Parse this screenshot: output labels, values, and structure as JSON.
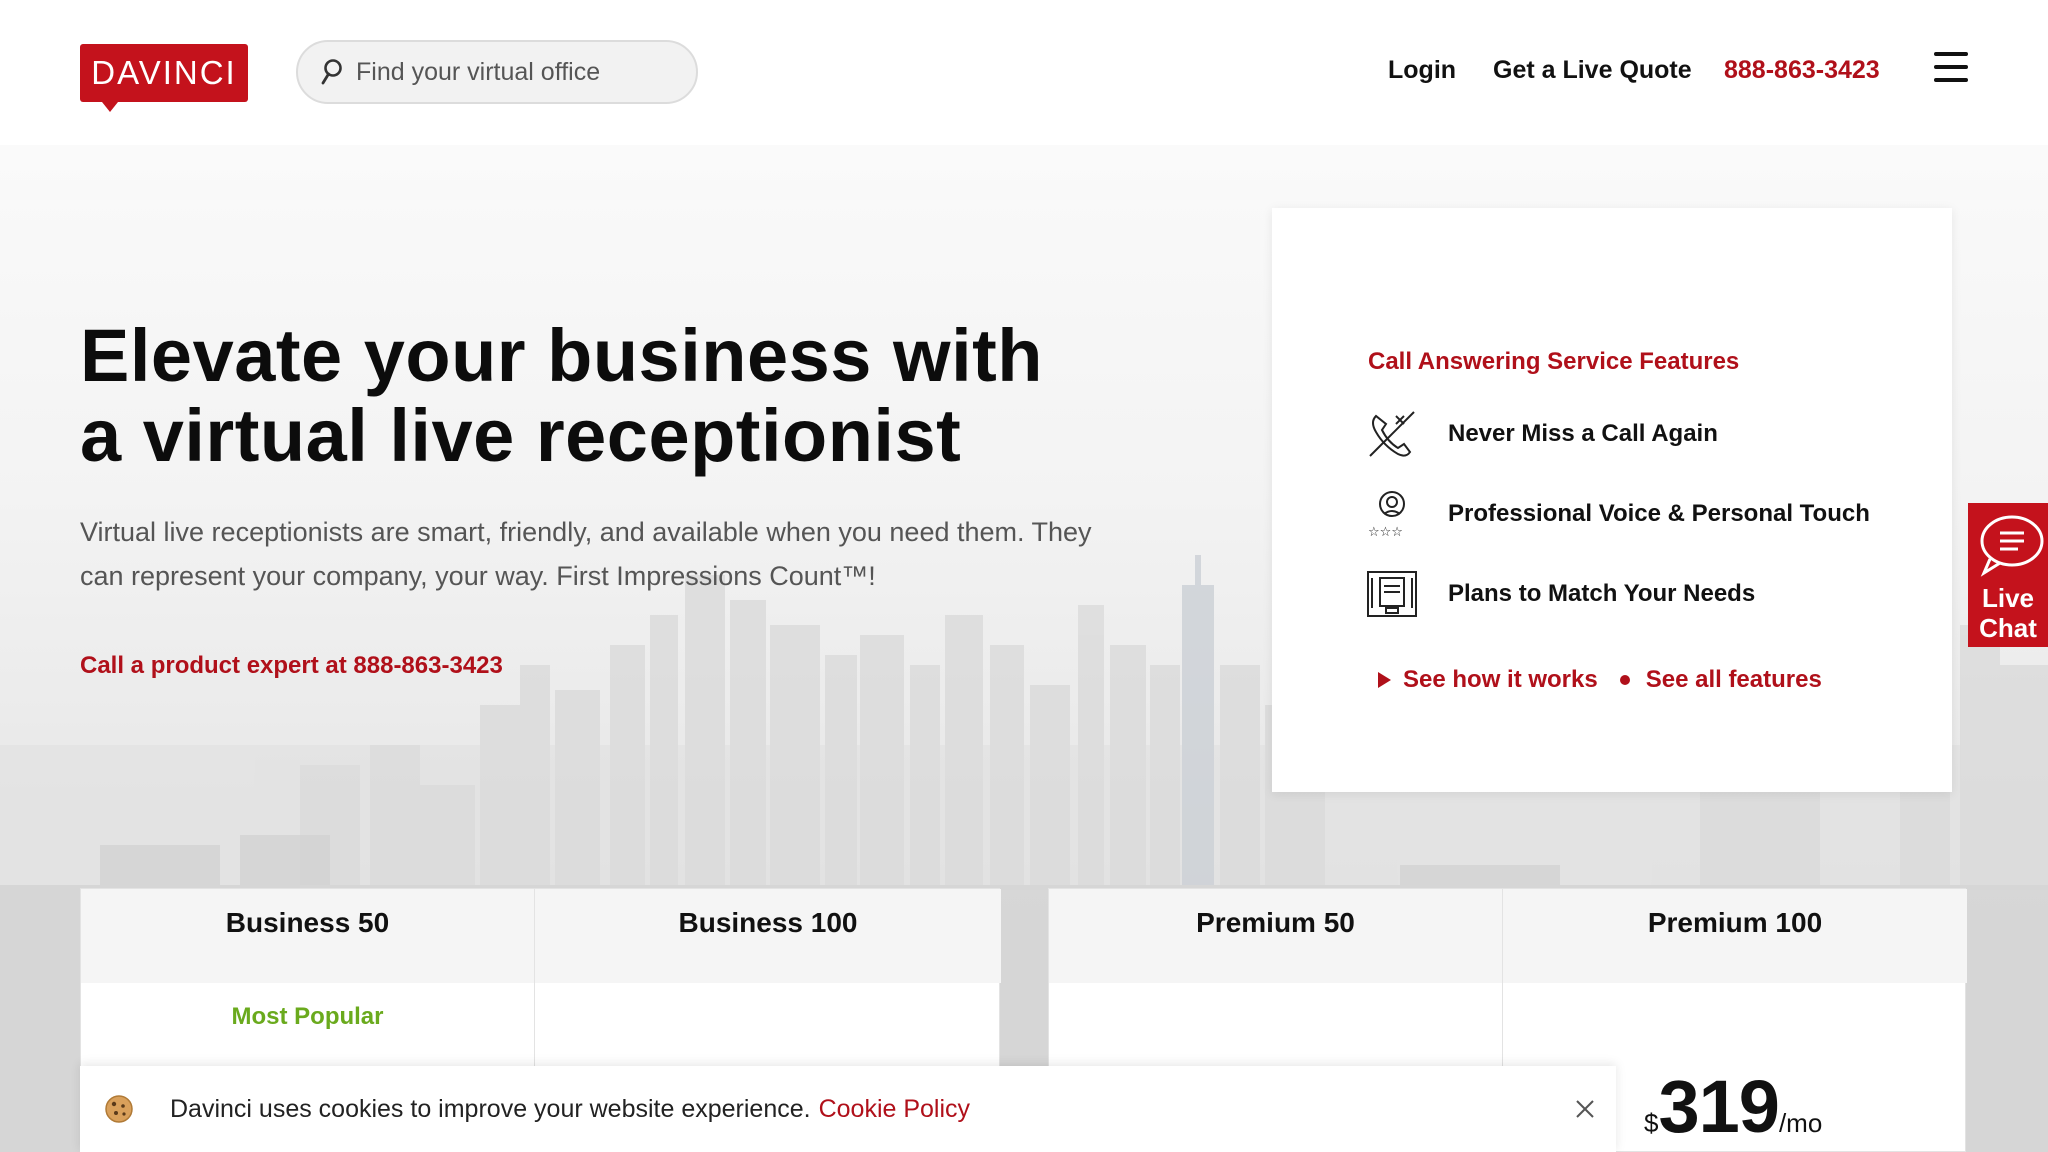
{
  "header": {
    "logo_text": "DAVINCI",
    "search_placeholder": "Find your virtual office",
    "nav": {
      "login": "Login",
      "quote": "Get a Live Quote",
      "phone": "888-863-3423"
    }
  },
  "hero": {
    "title": "Elevate your business with a virtual live receptionist",
    "subtitle": "Virtual live receptionists are smart, friendly, and available when you need them. They can represent your company, your way. First Impressions Count™!",
    "cta": "Call a product expert at 888-863-3423"
  },
  "features_card": {
    "title": "Call Answering Service Features",
    "items": [
      {
        "icon": "phone-missed-icon",
        "label": "Never Miss a Call Again"
      },
      {
        "icon": "receptionist-stars-icon",
        "label": "Professional Voice & Personal Touch"
      },
      {
        "icon": "plans-device-icon",
        "label": "Plans to Match Your Needs"
      }
    ],
    "link_how": "See how it works",
    "link_all": "See all features"
  },
  "live_chat": {
    "label": "Live Chat"
  },
  "plans": [
    {
      "name": "Business 50",
      "badge": "Most Popular"
    },
    {
      "name": "Business 100",
      "badge": ""
    },
    {
      "name": "Premium 50",
      "badge": ""
    },
    {
      "name": "Premium 100",
      "badge": ""
    }
  ],
  "cookie": {
    "text": "Davinci uses cookies to improve your website experience.",
    "link": "Cookie Policy"
  },
  "price": {
    "currency": "$",
    "amount": "319",
    "period": "/mo"
  },
  "colors": {
    "brand_red": "#c4121c",
    "link_red": "#b0101a",
    "badge_green": "#6aaa1d"
  }
}
